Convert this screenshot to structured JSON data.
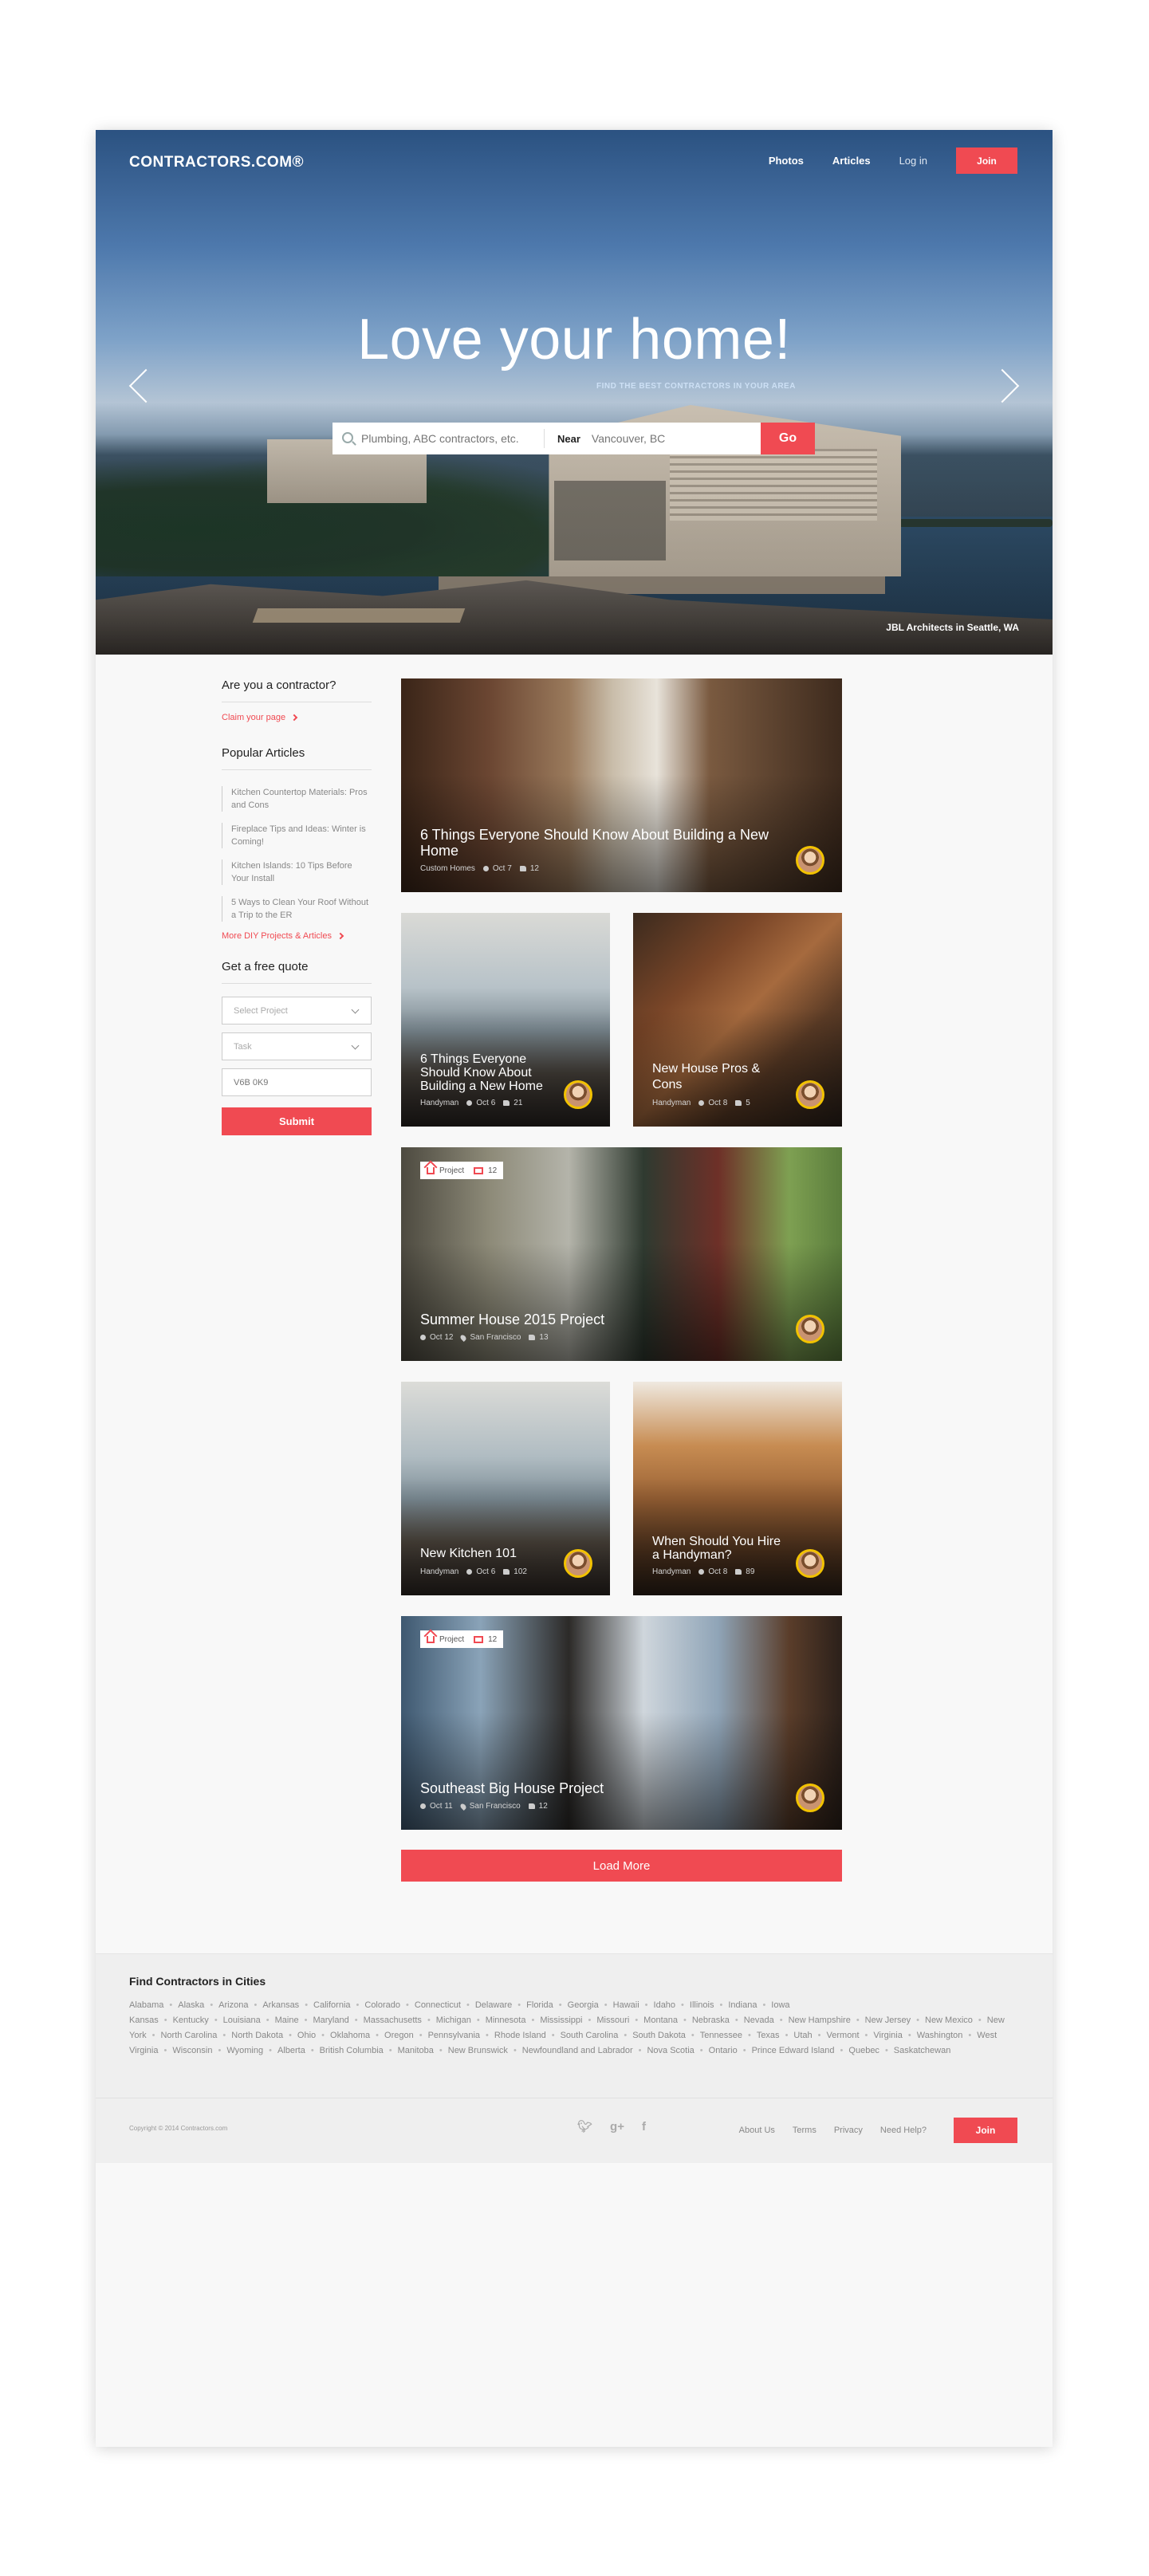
{
  "header": {
    "logo": "CONTRACTORS.COM®",
    "nav": [
      "Photos",
      "Articles",
      "Log in"
    ],
    "join_label": "Join"
  },
  "hero": {
    "title": "Love your home!",
    "subtitle": "FIND THE BEST CONTRACTORS IN YOUR AREA",
    "search_placeholder": "Plumbing, ABC contractors, etc.",
    "near_label": "Near",
    "near_placeholder": "Vancouver, BC",
    "go_label": "Go",
    "photo_credit": "JBL Architects in Seattle, WA"
  },
  "sidebar": {
    "contractor_heading": "Are you a contractor?",
    "claim_link": "Claim your page",
    "popular_heading": "Popular Articles",
    "popular_articles": [
      "Kitchen Countertop Materials: Pros and Cons",
      "Fireplace Tips and Ideas: Winter is Coming!",
      "Kitchen Islands: 10 Tips Before Your Install",
      "5 Ways to Clean Your Roof Without a Trip to the ER"
    ],
    "more_link": "More DIY Projects & Articles",
    "quote_heading": "Get a free quote",
    "select_project": "Select Project",
    "task": "Task",
    "postal_placeholder": "V6B 0K9",
    "submit_label": "Submit"
  },
  "cards": [
    {
      "title": "6 Things Everyone Should Know About Building a New Home",
      "category": "Custom Homes",
      "date": "Oct 7",
      "likes": "12"
    },
    {
      "title": "6 Things Everyone Should Know About Building a New Home",
      "category": "Handyman",
      "date": "Oct 6",
      "likes": "21"
    },
    {
      "title": "New House Pros & Cons",
      "category": "Handyman",
      "date": "Oct 8",
      "likes": "5"
    },
    {
      "title": "Summer House 2015 Project",
      "tag": "Project",
      "photos": "12",
      "date": "Oct 12",
      "location": "San Francisco",
      "likes": "13"
    },
    {
      "title": "New Kitchen 101",
      "category": "Handyman",
      "date": "Oct 6",
      "likes": "102"
    },
    {
      "title": "When Should You Hire a Handyman?",
      "category": "Handyman",
      "date": "Oct 8",
      "likes": "89"
    },
    {
      "title": "Southeast Big House Project",
      "tag": "Project",
      "photos": "12",
      "date": "Oct 11",
      "location": "San Francisco",
      "likes": "12"
    }
  ],
  "load_more_label": "Load More",
  "cities": {
    "title": "Find Contractors in Cities",
    "list": [
      "Alabama",
      "Alaska",
      "Arizona",
      "Arkansas",
      "California",
      "Colorado",
      "Connecticut",
      "Delaware",
      "Florida",
      "Georgia",
      "Hawaii",
      "Idaho",
      "Illinois",
      "Indiana",
      "Iowa Kansas",
      "Kentucky",
      "Louisiana",
      "Maine",
      "Maryland",
      "Massachusetts",
      "Michigan",
      "Minnesota",
      "Mississippi",
      "Missouri",
      "Montana",
      "Nebraska",
      "Nevada",
      "New Hampshire",
      "New Jersey",
      "New Mexico",
      "New York",
      "North Carolina",
      "North Dakota",
      "Ohio",
      "Oklahoma",
      "Oregon",
      "Pennsylvania",
      "Rhode Island",
      "South Carolina",
      "South Dakota",
      "Tennessee",
      "Texas",
      "Utah",
      "Vermont",
      "Virginia",
      "Washington",
      "West Virginia",
      "Wisconsin",
      "Wyoming",
      "Alberta",
      "British Columbia",
      "Manitoba",
      "New Brunswick",
      "Newfoundland and Labrador",
      "Nova Scotia",
      "Ontario",
      "Prince Edward Island",
      "Quebec",
      "Saskatchewan"
    ]
  },
  "footer": {
    "copyright": "Copyright © 2014 Contractors.com",
    "social": [
      "twitter-icon",
      "google-plus-icon",
      "facebook-icon"
    ],
    "links": [
      "About Us",
      "Terms",
      "Privacy",
      "Need Help?"
    ],
    "join_label": "Join"
  },
  "colors": {
    "accent": "#f04a52",
    "background": "#f8f8f8"
  }
}
